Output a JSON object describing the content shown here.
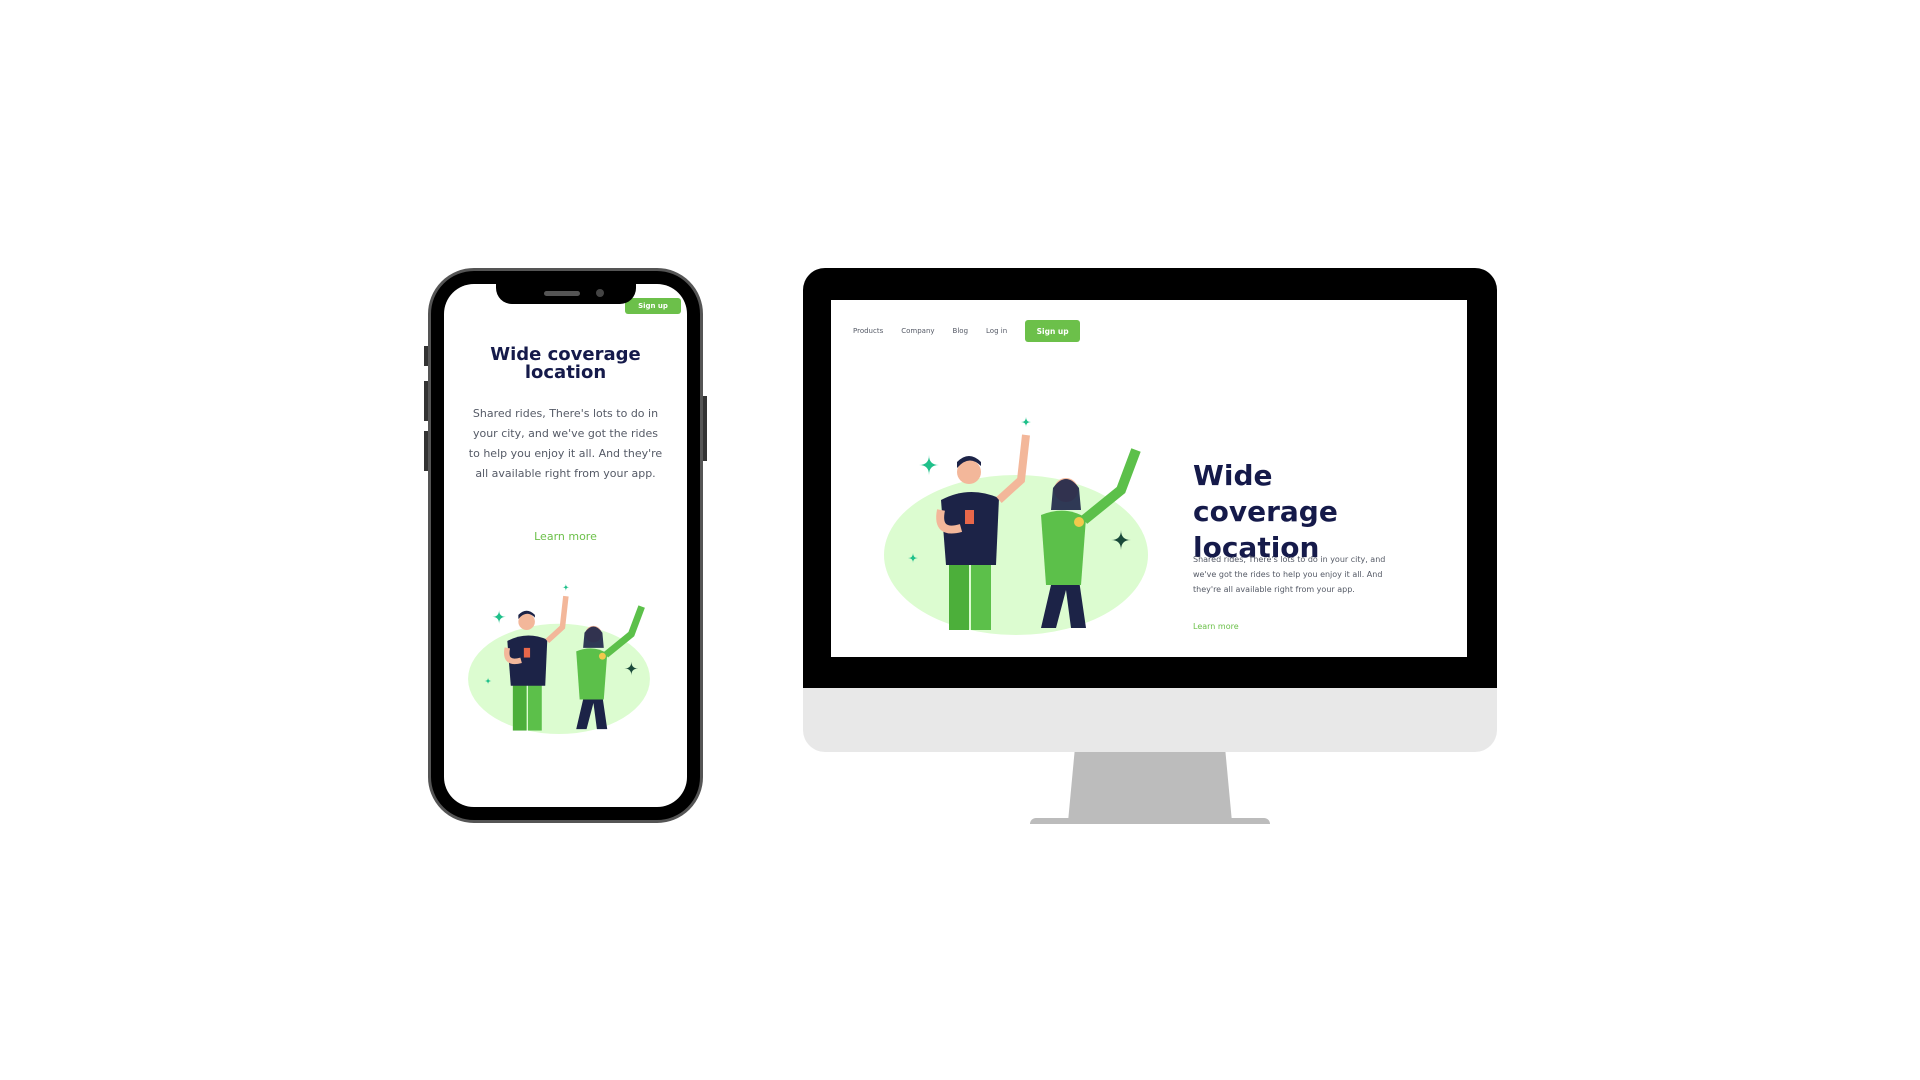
{
  "content": {
    "title": "Wide coverage location",
    "body": "Shared rides, There's lots to do in your city, and we've got the rides to help you enjoy it all. And they're all available right from your app.",
    "learn_more": "Learn more",
    "signup": "Sign up"
  },
  "nav": {
    "items": [
      "Products",
      "Company",
      "Blog",
      "Log in"
    ]
  },
  "colors": {
    "accent": "#6cc04a",
    "heading": "#151a4a",
    "blob": "#dcfcd0"
  }
}
